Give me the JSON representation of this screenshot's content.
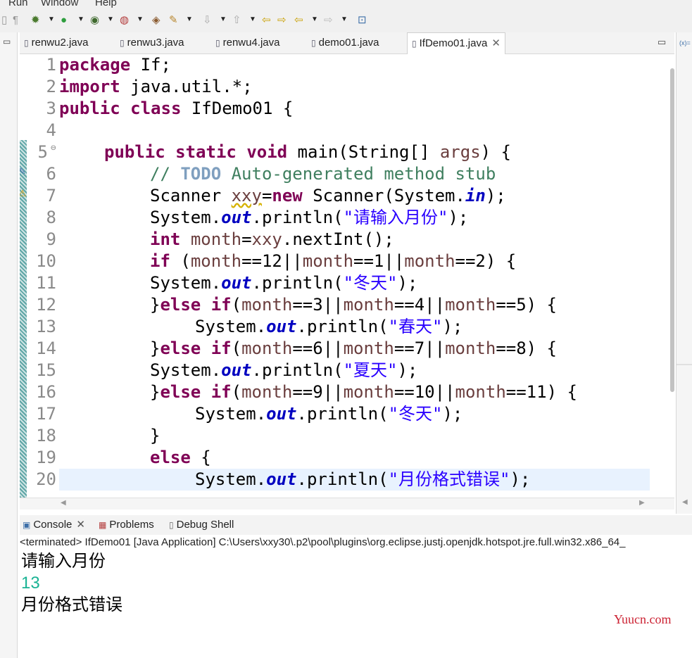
{
  "menu": [
    "Run",
    "Window",
    "Help"
  ],
  "tabs": [
    {
      "label": "renwu2.java",
      "active": false
    },
    {
      "label": "renwu3.java",
      "active": false
    },
    {
      "label": "renwu4.java",
      "active": false
    },
    {
      "label": "demo01.java",
      "active": false
    },
    {
      "label": "IfDemo01.java",
      "active": true
    }
  ],
  "right_panel_label": "(x)=",
  "line_numbers": [
    "1",
    "2",
    "3",
    "4",
    "5",
    "6",
    "7",
    "8",
    "9",
    "10",
    "11",
    "12",
    "13",
    "14",
    "15",
    "16",
    "17",
    "18",
    "19",
    "20"
  ],
  "code": {
    "l1": [
      "package",
      " If;"
    ],
    "l2": [
      "import",
      " java.util.*;"
    ],
    "l3": [
      "public",
      " ",
      "class",
      " IfDemo01 {"
    ],
    "l5": [
      "public",
      " ",
      "static",
      " ",
      "void",
      " main(String[] ",
      "args",
      ") {"
    ],
    "l6": [
      "// ",
      "TODO",
      " Auto-generated method stub"
    ],
    "l7": [
      "Scanner ",
      "xxy",
      "=",
      "new",
      " Scanner(System.",
      "in",
      ");"
    ],
    "l8": [
      "System.",
      "out",
      ".println(",
      "\"请输入月份\"",
      ");"
    ],
    "l9": [
      "int",
      " ",
      "month",
      "=",
      "xxy",
      ".nextInt();"
    ],
    "l10": [
      "if",
      " (",
      "month",
      "==12||",
      "month",
      "==1||",
      "month",
      "==2) {"
    ],
    "l11": [
      "System.",
      "out",
      ".println(",
      "\"冬天\"",
      ");"
    ],
    "l12": [
      "}",
      "else",
      " ",
      "if",
      "(",
      "month",
      "==3||",
      "month",
      "==4||",
      "month",
      "==5) {"
    ],
    "l13": [
      "System.",
      "out",
      ".println(",
      "\"春天\"",
      ");"
    ],
    "l14": [
      "}",
      "else",
      " ",
      "if",
      "(",
      "month",
      "==6||",
      "month",
      "==7||",
      "month",
      "==8) {"
    ],
    "l15": [
      "System.",
      "out",
      ".println(",
      "\"夏天\"",
      ");"
    ],
    "l16": [
      "}",
      "else",
      " ",
      "if",
      "(",
      "month",
      "==9||",
      "month",
      "==10||",
      "month",
      "==11) {"
    ],
    "l17": [
      "System.",
      "out",
      ".println(",
      "\"冬天\"",
      ");"
    ],
    "l18": [
      "}"
    ],
    "l19": [
      "else",
      " {"
    ],
    "l20": [
      "System.",
      "out",
      ".println(",
      "\"月份格式错误\"",
      ");"
    ]
  },
  "console": {
    "tabs": {
      "console": "Console",
      "problems": "Problems",
      "debug": "Debug Shell"
    },
    "status": "<terminated> IfDemo01 [Java Application] C:\\Users\\xxy30\\.p2\\pool\\plugins\\org.eclipse.justj.openjdk.hotspot.jre.full.win32.x86_64_",
    "output": [
      "请输入月份",
      "13",
      "月份格式错误"
    ],
    "input_color": "#1ab394"
  },
  "colors": {
    "keyword": "#7f0055",
    "string": "#2a00ff",
    "field": "#0000c0",
    "variable": "#6a3e3e",
    "comment": "#3f7f5f",
    "current_line": "#e8f2fe"
  },
  "watermark": "Yuucn.com"
}
